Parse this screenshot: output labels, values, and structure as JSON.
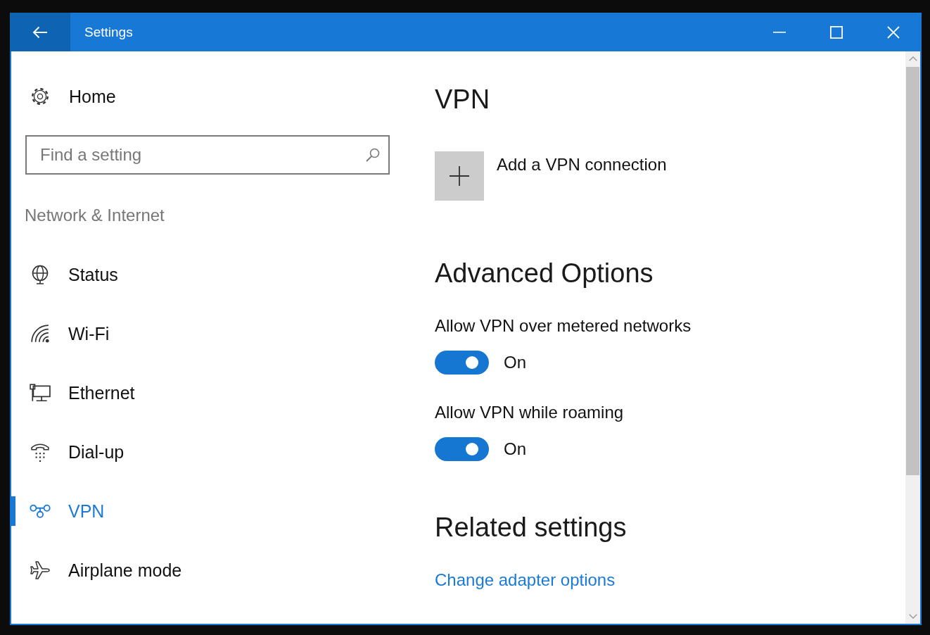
{
  "window": {
    "title": "Settings"
  },
  "sidebar": {
    "home": "Home",
    "search": {
      "placeholder": "Find a setting"
    },
    "section": "Network & Internet",
    "items": [
      {
        "label": "Status",
        "selected": false
      },
      {
        "label": "Wi-Fi",
        "selected": false
      },
      {
        "label": "Ethernet",
        "selected": false
      },
      {
        "label": "Dial-up",
        "selected": false
      },
      {
        "label": "VPN",
        "selected": true
      },
      {
        "label": "Airplane mode",
        "selected": false
      }
    ]
  },
  "content": {
    "title": "VPN",
    "add_connection": "Add a VPN connection",
    "advanced": {
      "title": "Advanced Options",
      "toggles": [
        {
          "label": "Allow VPN over metered networks",
          "on": true,
          "state": "On"
        },
        {
          "label": "Allow VPN while roaming",
          "on": true,
          "state": "On"
        }
      ]
    },
    "related": {
      "title": "Related settings",
      "links": [
        "Change adapter options"
      ]
    }
  }
}
